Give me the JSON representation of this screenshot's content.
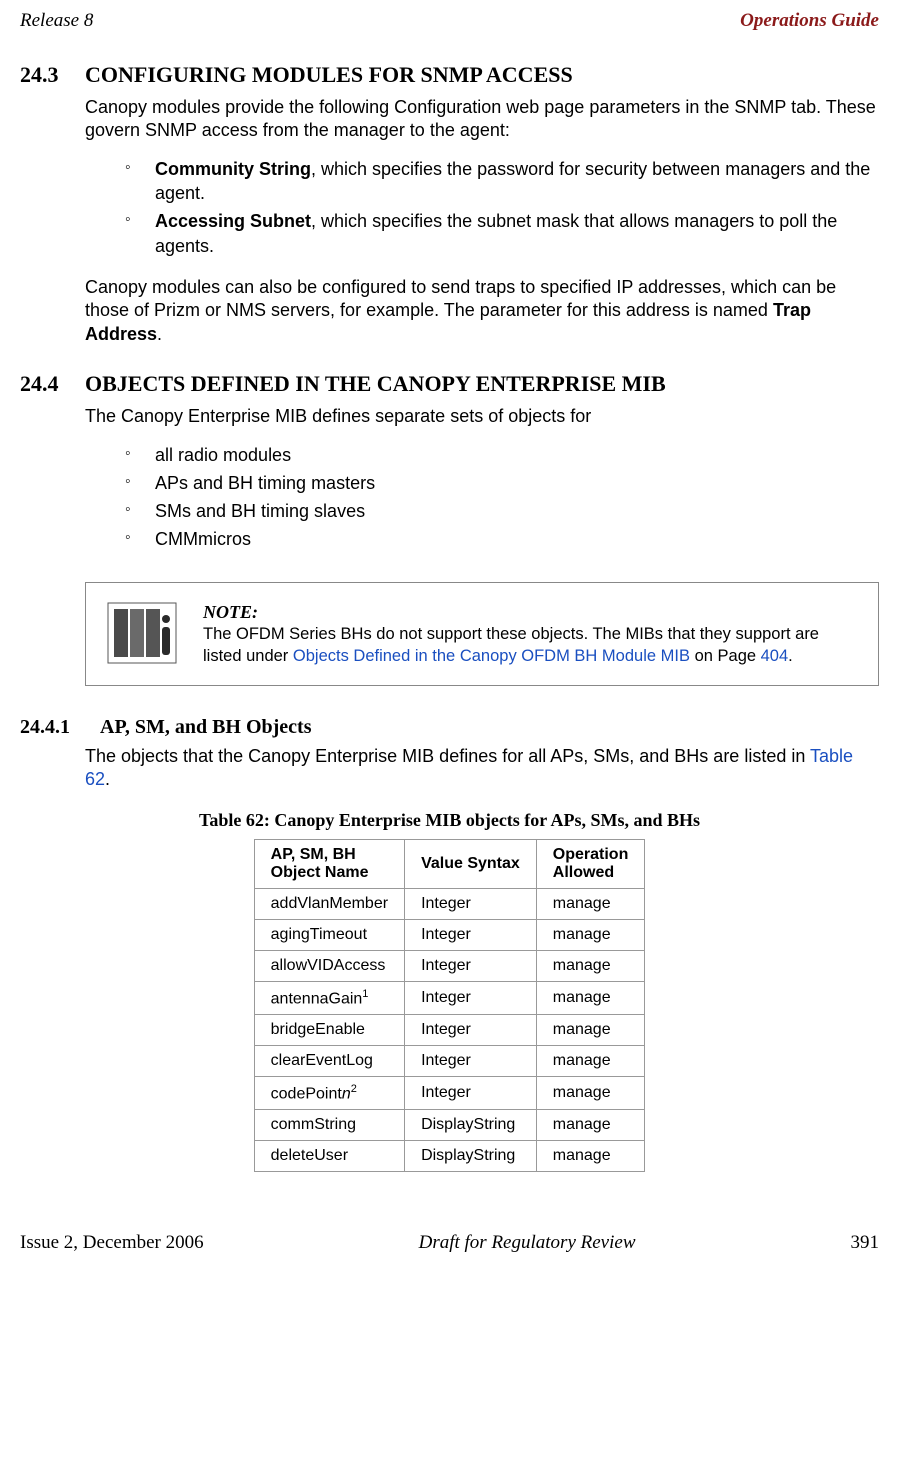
{
  "header": {
    "left": "Release 8",
    "right": "Operations Guide"
  },
  "sec243": {
    "num": "24.3",
    "title": "CONFIGURING MODULES FOR SNMP ACCESS",
    "intro": "Canopy modules provide the following Configuration web page parameters in the SNMP tab. These govern SNMP access from the manager to the agent:",
    "bullet1_bold": "Community String",
    "bullet1_rest": ", which specifies the password for security between managers and the agent.",
    "bullet2_bold": "Accessing Subnet",
    "bullet2_rest": ", which specifies the subnet mask that allows managers to poll the agents.",
    "para2a": "Canopy modules can also be configured to send traps to specified IP addresses, which can be those of Prizm or NMS servers, for example. The parameter for this address is named ",
    "para2b_bold": "Trap Address",
    "para2c": "."
  },
  "sec244": {
    "num": "24.4",
    "title": "OBJECTS DEFINED IN THE CANOPY ENTERPRISE MIB",
    "intro": "The Canopy Enterprise MIB defines separate sets of objects for",
    "items": [
      "all radio modules",
      "APs and BH timing masters",
      "SMs and BH timing slaves",
      "CMMmicros"
    ]
  },
  "note": {
    "title": "NOTE:",
    "t1": "The OFDM Series BHs do not support these objects. The MIBs that they support are listed under ",
    "link": "Objects Defined in the Canopy OFDM BH Module MIB",
    "t2": " on Page ",
    "page": "404",
    "t3": "."
  },
  "sec2441": {
    "num": "24.4.1",
    "title": "AP, SM, and BH Objects",
    "intro_a": "The objects that the Canopy Enterprise MIB defines for all APs, SMs, and BHs are listed in ",
    "intro_link": "Table 62",
    "intro_b": "."
  },
  "table": {
    "caption": "Table 62: Canopy Enterprise MIB objects for APs, SMs, and BHs",
    "h1a": "AP, SM, BH",
    "h1b": "Object Name",
    "h2": "Value Syntax",
    "h3a": "Operation",
    "h3b": "Allowed",
    "rows": [
      {
        "name": "addVlanMember",
        "sup": "",
        "italic": "",
        "syntax": "Integer",
        "op": "manage"
      },
      {
        "name": "agingTimeout",
        "sup": "",
        "italic": "",
        "syntax": "Integer",
        "op": "manage"
      },
      {
        "name": "allowVIDAccess",
        "sup": "",
        "italic": "",
        "syntax": "Integer",
        "op": "manage"
      },
      {
        "name": "antennaGain",
        "sup": "1",
        "italic": "",
        "syntax": "Integer",
        "op": "manage"
      },
      {
        "name": "bridgeEnable",
        "sup": "",
        "italic": "",
        "syntax": "Integer",
        "op": "manage"
      },
      {
        "name": "clearEventLog",
        "sup": "",
        "italic": "",
        "syntax": "Integer",
        "op": "manage"
      },
      {
        "name": "codePoint",
        "sup": "2",
        "italic": "n",
        "syntax": "Integer",
        "op": "manage"
      },
      {
        "name": "commString",
        "sup": "",
        "italic": "",
        "syntax": "DisplayString",
        "op": "manage"
      },
      {
        "name": "deleteUser",
        "sup": "",
        "italic": "",
        "syntax": "DisplayString",
        "op": "manage"
      }
    ]
  },
  "footer": {
    "left": "Issue 2, December 2006",
    "mid": "Draft for Regulatory Review",
    "right": "391"
  }
}
